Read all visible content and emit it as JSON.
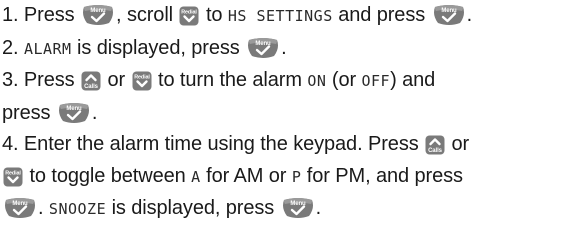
{
  "colors": {
    "key_fill": "#7a7a7a",
    "key_dark": "#333333",
    "text": "#1a1a1a"
  },
  "icons": {
    "menu_key": "menu-ok-key-icon",
    "redial_key": "redial-down-key-icon",
    "calls_key": "calls-up-key-icon"
  },
  "key_text": {
    "menu": "Menu",
    "redial": "Redial",
    "calls": "Calls"
  },
  "steps": [
    {
      "p1": "1. Press ",
      "p2": ", scroll ",
      "p3": " to ",
      "lcd1": "HS SETTINGS",
      "p4": " and press ",
      "p5": "."
    },
    {
      "lcd1": "ALARM",
      "p1": " is displayed, press ",
      "p2": ".",
      "num": "2. "
    },
    {
      "num": "3. Press ",
      "p1": " or ",
      "p2": " to turn the alarm ",
      "lcd1": "ON",
      "p3": " (or ",
      "lcd2": "OFF",
      "p4": ") and",
      "p5": "press ",
      "p6": "."
    },
    {
      "num": "4. Enter the alarm time using the keypad. Press ",
      "p1": " or",
      "p2": " to toggle between ",
      "lcd1": "A",
      "p3": " for AM or ",
      "lcd2": "P",
      "p4": " for PM, and press",
      "p5": ". ",
      "lcd3": "SNOOZE",
      "p6": " is displayed, press ",
      "p7": "."
    }
  ]
}
